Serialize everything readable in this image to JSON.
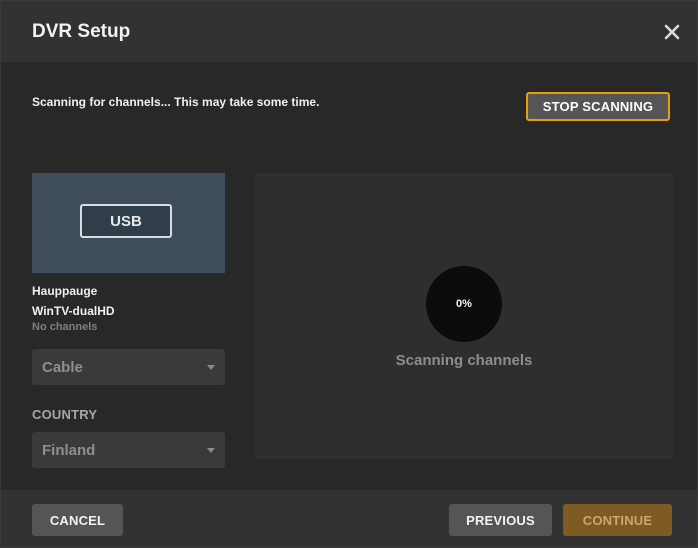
{
  "dialog": {
    "title": "DVR Setup",
    "close_icon": "close-icon"
  },
  "scan": {
    "status_text": "Scanning for channels... This may take some time.",
    "stop_label": "STOP SCANNING",
    "progress_text": "0%",
    "progress_value": 0,
    "panel_label": "Scanning channels"
  },
  "device": {
    "connection_label": "USB",
    "brand": "Hauppauge",
    "model": "WinTV-dualHD",
    "channels": "No channels"
  },
  "form": {
    "source_select": "Cable",
    "country_label": "COUNTRY",
    "country_select": "Finland"
  },
  "footer": {
    "cancel_label": "CANCEL",
    "previous_label": "PREVIOUS",
    "continue_label": "CONTINUE"
  },
  "colors": {
    "accent": "#e5a00d",
    "continue_bg": "#7f5b23",
    "thumb_bg": "#3f4c5a"
  }
}
